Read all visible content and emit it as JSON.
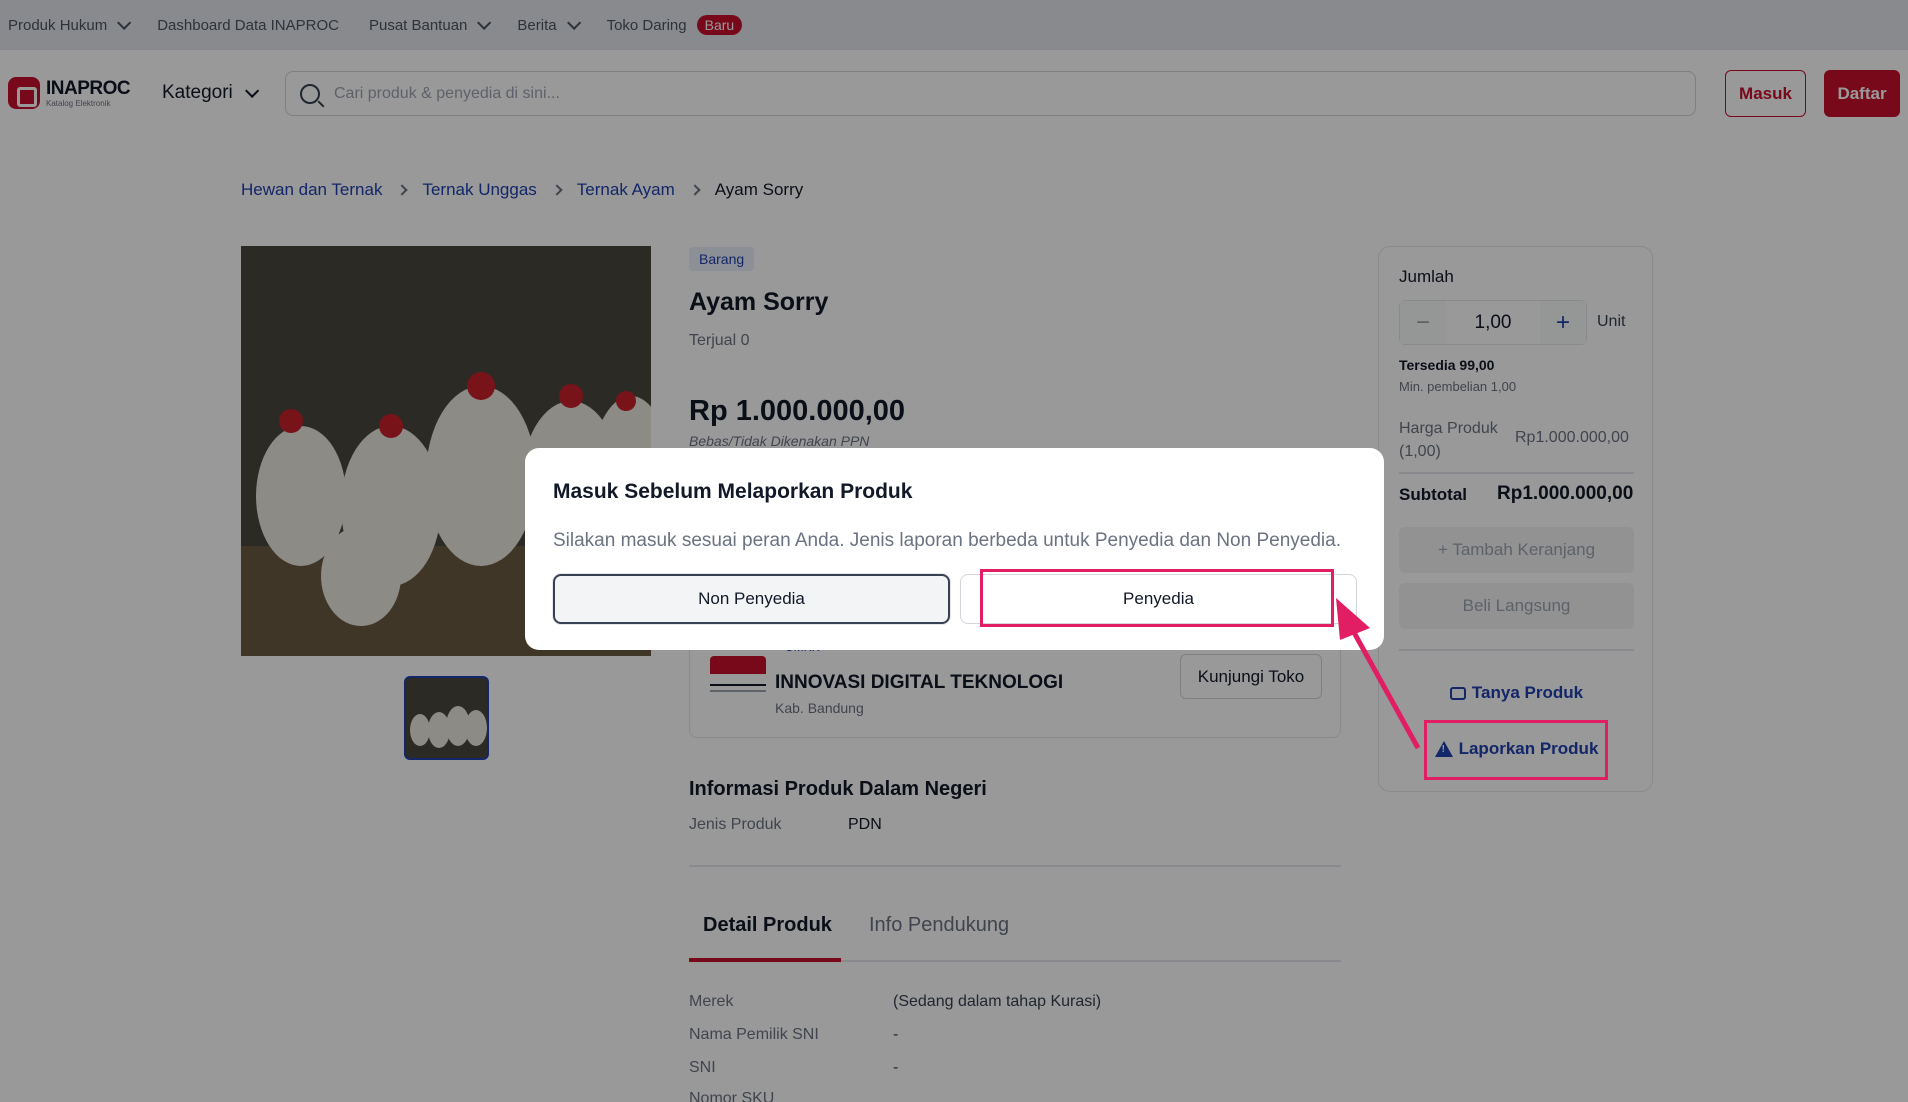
{
  "topbar": {
    "items": [
      {
        "label": "Produk Hukum",
        "dropdown": true
      },
      {
        "label": "Dashboard Data INAPROC",
        "dropdown": false
      },
      {
        "label": "Pusat Bantuan",
        "dropdown": true
      },
      {
        "label": "Berita",
        "dropdown": true
      },
      {
        "label": "Toko Daring",
        "dropdown": false,
        "badge": "Baru"
      }
    ]
  },
  "header": {
    "logo_primary": "INAPROC",
    "logo_sub": "Katalog Elektronik",
    "kategori": "Kategori",
    "search_placeholder": "Cari produk & penyedia di sini...",
    "login": "Masuk",
    "register": "Daftar"
  },
  "breadcrumb": [
    "Hewan dan Ternak",
    "Ternak Unggas",
    "Ternak Ayam",
    "Ayam Sorry"
  ],
  "product": {
    "tag": "Barang",
    "title": "Ayam Sorry",
    "sold": "Terjual 0",
    "price": "Rp 1.000.000,00",
    "tax_note": "Bebas/Tidak Dikenakan PPN"
  },
  "seller": {
    "badge": "UMKK",
    "name": "INNOVASI DIGITAL TEKNOLOGI",
    "location": "Kab. Bandung",
    "visit": "Kunjungi Toko"
  },
  "pdn": {
    "title": "Informasi Produk Dalam Negeri",
    "label": "Jenis Produk",
    "value": "PDN"
  },
  "tabs": [
    "Detail Produk",
    "Info Pendukung"
  ],
  "specs": [
    {
      "label": "Merek",
      "value": "(Sedang dalam tahap Kurasi)"
    },
    {
      "label": "Nama Pemilik SNI",
      "value": "-"
    },
    {
      "label": "SNI",
      "value": "-"
    },
    {
      "label": "Nomor SKU",
      "value": ""
    }
  ],
  "panel": {
    "quantity_label": "Jumlah",
    "quantity": "1,00",
    "unit": "Unit",
    "stock": "Tersedia 99,00",
    "min": "Min. pembelian 1,00",
    "price_label": "Harga Produk (1,00)",
    "price_value": "Rp1.000.000,00",
    "subtotal_label": "Subtotal",
    "subtotal_value": "Rp1.000.000,00",
    "add_cart": "+ Tambah Keranjang",
    "buy_now": "Beli Langsung",
    "ask": "Tanya Produk",
    "report": "Laporkan Produk"
  },
  "modal": {
    "title": "Masuk Sebelum Melaporkan Produk",
    "body": "Silakan masuk sesuai peran Anda. Jenis laporan berbeda untuk Penyedia dan Non Penyedia.",
    "non_penyedia": "Non Penyedia",
    "penyedia": "Penyedia"
  },
  "colors": {
    "brand": "#c8102e",
    "link": "#1e40af",
    "annotation": "#e11d63"
  }
}
